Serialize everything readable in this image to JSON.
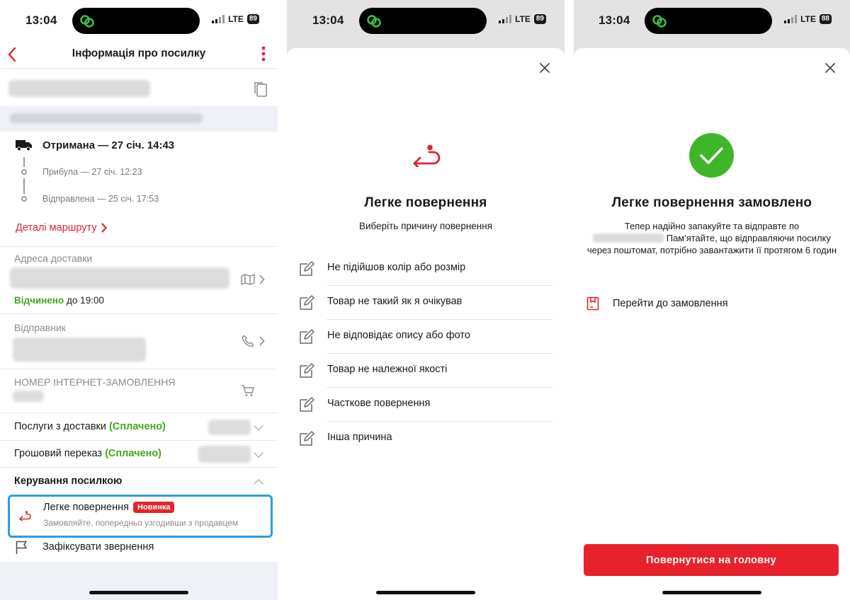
{
  "colors": {
    "accent_red": "#e2242b",
    "success_green": "#40a81e",
    "highlight_blue": "#2a9ee0"
  },
  "screens": [
    {
      "status": {
        "time": "13:04",
        "network": "LTE",
        "battery": "89"
      },
      "header": {
        "title": "Інформація про посилку",
        "back_icon": "chevron-left-icon",
        "menu_icon": "more-vertical-icon"
      },
      "tracking": {
        "current": "Отримана — 27 січ. 14:43",
        "arrived": "Прибула — 27 січ. 12:23",
        "sent": "Відправлена — 25 січ. 17:53",
        "route_link": "Деталі маршруту"
      },
      "delivery": {
        "label": "Адреса доставки",
        "open_status": "Відчинено",
        "open_until": "до 19:00"
      },
      "sender": {
        "label": "Відправник"
      },
      "order": {
        "label": "НОМЕР ІНТЕРНЕТ-ЗАМОВЛЕННЯ"
      },
      "services": {
        "label": "Послуги з доставки",
        "status": "(Сплачено)"
      },
      "money_transfer": {
        "label": "Грошовий переказ",
        "status": "(Сплачено)"
      },
      "manage": {
        "title": "Керування посилкою",
        "easy_return": {
          "title": "Легке повернення",
          "badge": "Новинка",
          "subtitle": "Замовляйте, попередньо узгодивши з продавцем"
        },
        "report": "Зафіксувати звернення"
      }
    },
    {
      "status": {
        "time": "13:04",
        "network": "LTE",
        "battery": "89"
      },
      "title": "Легке повернення",
      "subtitle": "Виберіть причину повернення",
      "reasons": [
        "Не підійшов колір або розмір",
        "Товар не такий як я очікував",
        "Не відповідає опису або фото",
        "Товар не належної якості",
        "Часткове повернення",
        "Інша причина"
      ]
    },
    {
      "status": {
        "time": "13:04",
        "network": "LTE",
        "battery": "88"
      },
      "title": "Легке повернення замовлено",
      "desc_part1": "Тепер надійно запакуйте та відправте по",
      "desc_part2": "Пам'ятайте, що відправляючи посилку через поштомат, потрібно завантажити її протягом 6 годин",
      "order_link": "Перейти до замовлення",
      "home_button": "Повернутися на головну"
    }
  ]
}
